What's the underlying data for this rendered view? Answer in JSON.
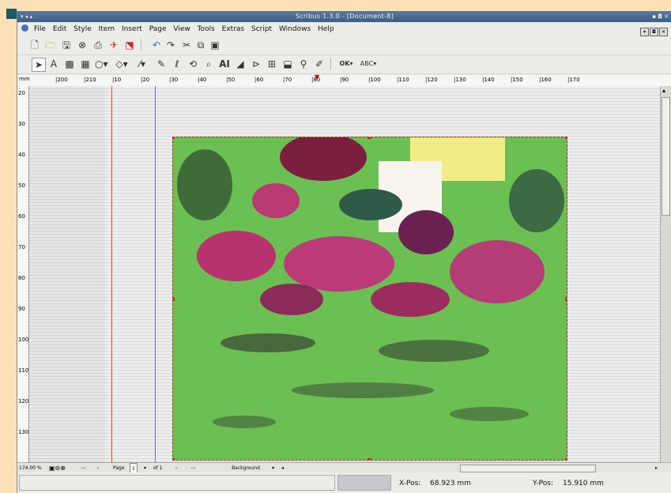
{
  "window": {
    "title": "Scribus 1.3.0 - [Document-8]"
  },
  "menu": [
    "File",
    "Edit",
    "Style",
    "Item",
    "Insert",
    "Page",
    "View",
    "Tools",
    "Extras",
    "Script",
    "Windows",
    "Help"
  ],
  "ruler": {
    "unit": "mm",
    "h_ticks": [
      "|200",
      "|210",
      "|10",
      "|20",
      "|30",
      "|40",
      "|50",
      "|60",
      "|70",
      "|80",
      "|90",
      "|100",
      "|110",
      "|120",
      "|130",
      "|140",
      "|150",
      "|160",
      "|170"
    ],
    "v_ticks": [
      "20",
      "30",
      "40",
      "50",
      "60",
      "70",
      "80",
      "90",
      "100",
      "110",
      "120",
      "130"
    ]
  },
  "bottom": {
    "zoom": "174.00 %",
    "page_label": "Page",
    "page_value": "1",
    "of_label": "of 1",
    "layer": "Background"
  },
  "status": {
    "x_label": "X-Pos:",
    "x_value": "68.923 mm",
    "y_label": "Y-Pos:",
    "y_value": "15.910 mm"
  },
  "colors": {
    "accent": "#6cbf52",
    "title": "#3e5e80",
    "frame": "#c02020"
  }
}
